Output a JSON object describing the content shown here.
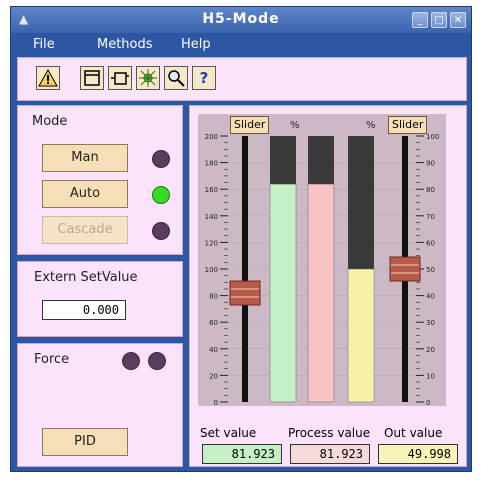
{
  "window": {
    "title": "H5-Mode"
  },
  "menu": [
    "File",
    "Methods",
    "Help"
  ],
  "toolbar": {
    "help_label": "?"
  },
  "mode": {
    "title": "Mode",
    "buttons": [
      {
        "label": "Man",
        "enabled": true,
        "led": "off"
      },
      {
        "label": "Auto",
        "enabled": true,
        "led": "on"
      },
      {
        "label": "Cascade",
        "enabled": false,
        "led": "off"
      }
    ]
  },
  "extern": {
    "title": "Extern SetValue",
    "value": "0.000"
  },
  "force": {
    "title": "Force",
    "pid_label": "PID"
  },
  "chart_data": {
    "type": "bar",
    "slider_labels": [
      "Slider",
      "Slider"
    ],
    "units": [
      "%",
      "%"
    ],
    "left_axis": {
      "min": 0,
      "max": 200,
      "ticks": [
        "0",
        "20",
        "40",
        "60",
        "80",
        "100",
        "120",
        "140",
        "160",
        "180",
        "200"
      ]
    },
    "right_axis": {
      "min": 0,
      "max": 100,
      "ticks": [
        "0",
        "10",
        "20",
        "30",
        "40",
        "50",
        "60",
        "70",
        "80",
        "90",
        "100"
      ]
    },
    "bars": [
      {
        "name": "Set value",
        "value": 81.923,
        "color": "#c5efc5"
      },
      {
        "name": "Process value",
        "value": 81.923,
        "color": "#f6c4c4"
      },
      {
        "name": "Out value",
        "value": 49.998,
        "color": "#f6f0a8"
      }
    ],
    "left_slider_value": 81.923,
    "right_slider_value": 49.998
  },
  "values": {
    "set_label": "Set value",
    "process_label": "Process value",
    "out_label": "Out value",
    "set": "81.923",
    "process": "81.923",
    "out": "49.998"
  }
}
